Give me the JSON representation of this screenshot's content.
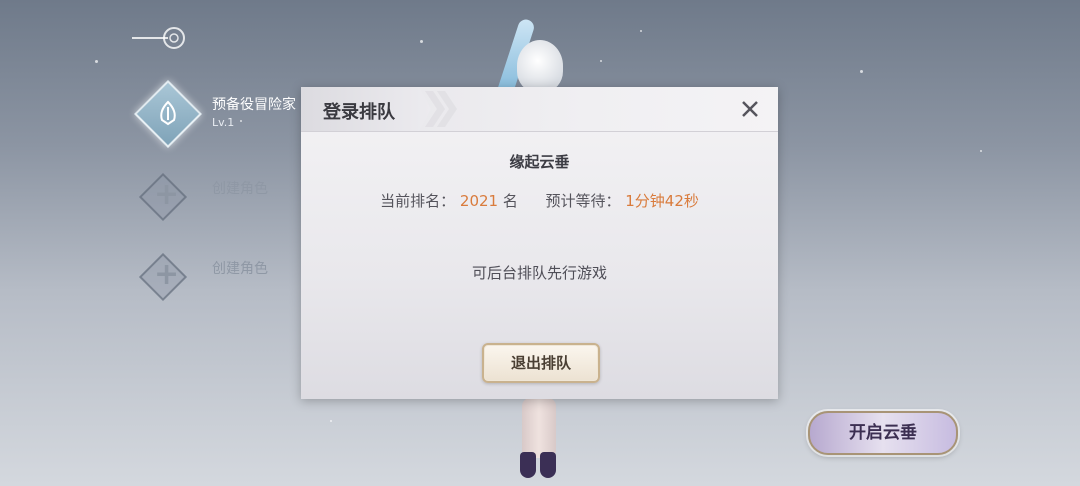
{
  "sidebar": {
    "back_icon": "back-arrow-icon",
    "slots": [
      {
        "name": "预备役冒险家",
        "level": "Lv.1",
        "icon": "emblem-icon"
      },
      {
        "create_label": "创建角色",
        "icon": "plus-icon"
      },
      {
        "create_label": "创建角色",
        "icon": "plus-icon"
      }
    ]
  },
  "dialog": {
    "title": "登录排队",
    "close_icon": "close-icon",
    "server_name": "缘起云垂",
    "rank_label": "当前排名：",
    "rank_value": "2021",
    "rank_unit": "名",
    "wait_label": "预计等待：",
    "wait_value": "1分钟42秒",
    "hint": "可后台排队先行游戏",
    "exit_button": "退出排队"
  },
  "start_button": "开启云垂",
  "colors": {
    "accent_orange": "#d97b3c",
    "button_border": "#c9b28e"
  }
}
